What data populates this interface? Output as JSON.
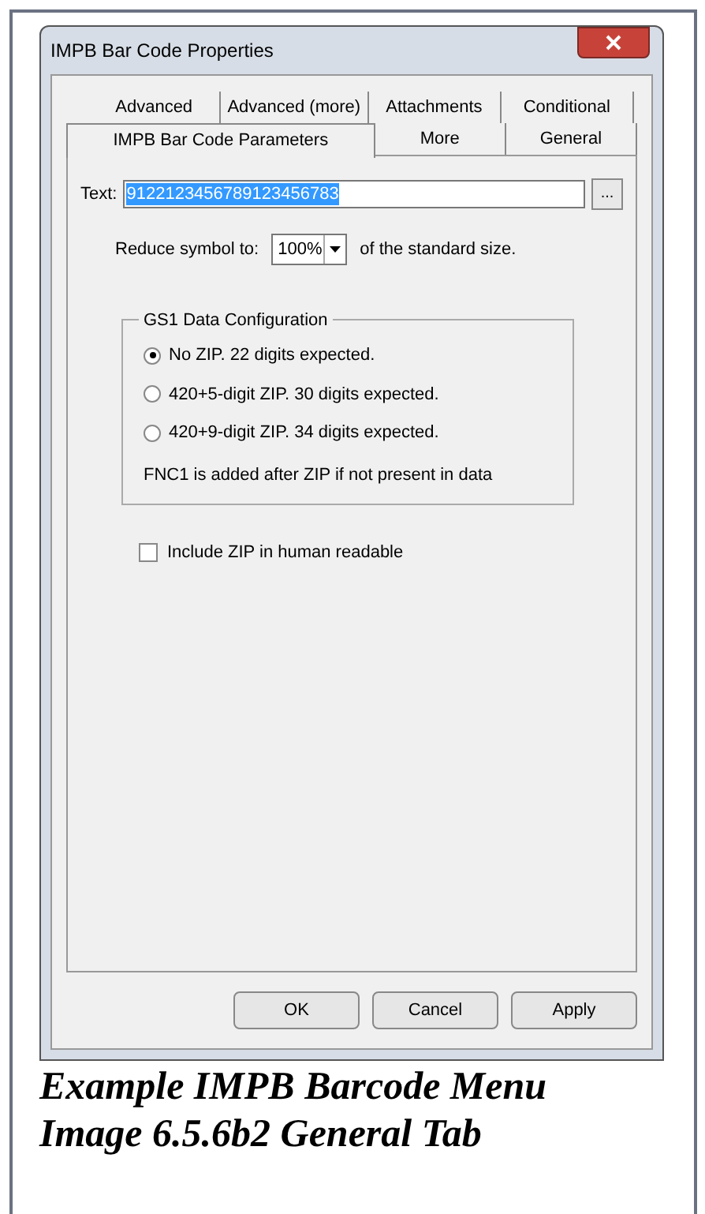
{
  "window": {
    "title": "IMPB Bar Code Properties"
  },
  "tab_rows": [
    [
      {
        "label": "Advanced",
        "selected": false
      },
      {
        "label": "Advanced (more)",
        "selected": false
      },
      {
        "label": "Attachments",
        "selected": false
      },
      {
        "label": "Conditional",
        "selected": false
      }
    ],
    [
      {
        "label": "IMPB Bar Code Parameters",
        "selected": true
      },
      {
        "label": "More",
        "selected": false
      },
      {
        "label": "General",
        "selected": false
      }
    ]
  ],
  "text_field": {
    "label": "Text:",
    "value": "9122123456789123456783",
    "browse": "..."
  },
  "reduce": {
    "label": "Reduce symbol to:",
    "value": "100%",
    "suffix": "of the standard size."
  },
  "group": {
    "title": "GS1 Data Configuration",
    "options": [
      {
        "label": "No ZIP.  22 digits expected.",
        "selected": true
      },
      {
        "label": "420+5-digit ZIP.  30 digits expected.",
        "selected": false
      },
      {
        "label": "420+9-digit ZIP.  34 digits expected.",
        "selected": false
      }
    ],
    "note": "FNC1 is added after ZIP if not present in data"
  },
  "checkbox": {
    "label": "Include ZIP in human readable",
    "checked": false
  },
  "buttons": [
    "OK",
    "Cancel",
    "Apply"
  ],
  "caption": [
    "Example IMPB Barcode Menu",
    "Image 6.5.6b2 General Tab"
  ]
}
